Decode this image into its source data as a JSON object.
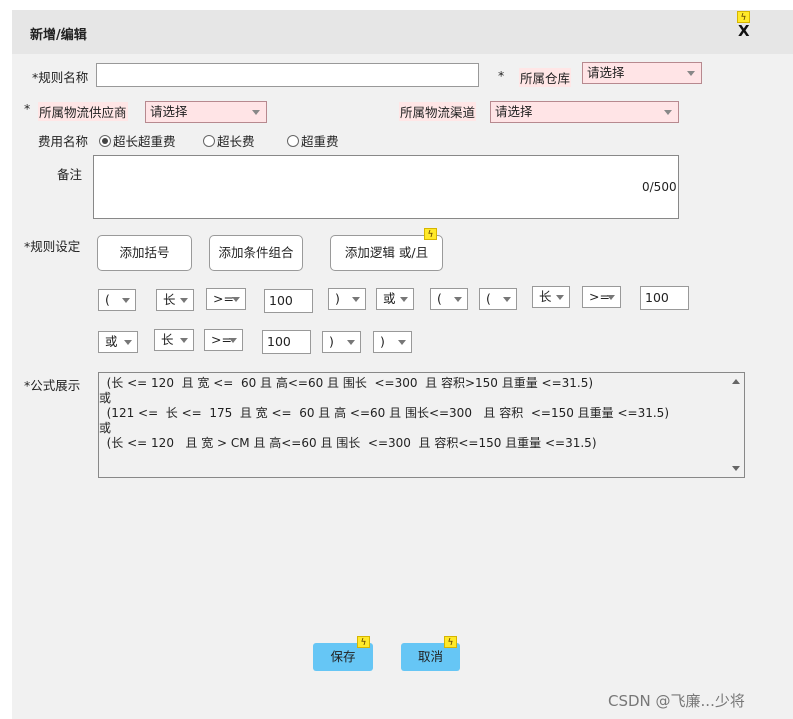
{
  "dialog": {
    "title": "新增/编辑",
    "close_label": "X"
  },
  "icons": {
    "bolt": "ϟ"
  },
  "form": {
    "rule_name": {
      "label": "*规则名称",
      "value": ""
    },
    "warehouse": {
      "star": "*",
      "label": "所属仓库",
      "value": "请选择"
    },
    "supplier": {
      "star": "*",
      "label": "所属物流供应商",
      "value": "请选择"
    },
    "channel": {
      "label": "所属物流渠道",
      "value": "请选择"
    },
    "fee": {
      "label": "费用名称",
      "options": [
        "超长超重费",
        "超长费",
        "超重费"
      ],
      "selected": "超长超重费"
    },
    "remark": {
      "label": "备注",
      "value": "",
      "counter": "0/500"
    }
  },
  "rules": {
    "label": "*规则设定",
    "buttons": [
      "添加括号",
      "添加条件组合",
      "添加逻辑 或/且"
    ],
    "row1": [
      "(",
      "长",
      ">=",
      "100",
      ")",
      "或",
      "(",
      "(",
      "长",
      ">=",
      "100"
    ],
    "row2": [
      "或",
      "长",
      ">=",
      "100",
      ")",
      ")"
    ]
  },
  "formula": {
    "label": "*公式展示",
    "lines": [
      "  (长 <= 120  且 宽 <=  60 且 高<=60 且 围长  <=300  且 容积>150 且重量 <=31.5)",
      "或",
      "  (121 <=  长 <=  175  且 宽 <=  60 且 高 <=60 且 围长<=300   且 容积  <=150 且重量 <=31.5)",
      "或",
      "  (长 <= 120   且 宽 > CM 且 高<=60 且 围长  <=300  且 容积<=150 且重量 <=31.5)"
    ]
  },
  "actions": {
    "save": "保存",
    "cancel": "取消"
  },
  "watermark": "CSDN @飞廉...少将"
}
